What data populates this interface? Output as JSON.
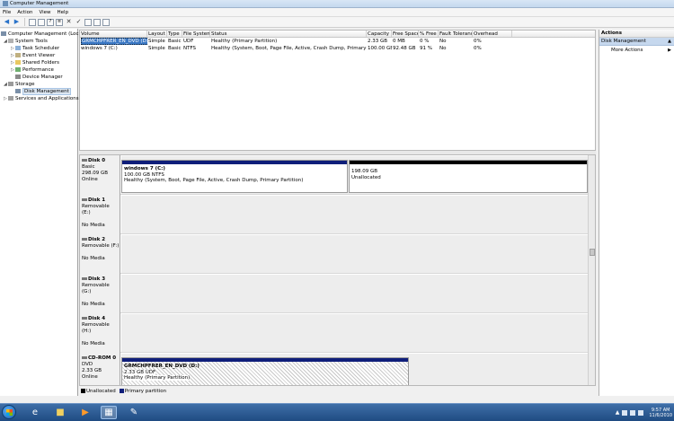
{
  "window": {
    "title": "Computer Management"
  },
  "menu": [
    "File",
    "Action",
    "View",
    "Help"
  ],
  "toolbar": {
    "icons": [
      "back-arrow-icon",
      "forward-arrow-icon",
      "up-folder-icon",
      "properties-icon",
      "help-icon",
      "list-icon",
      "delete-icon",
      "check-icon",
      "export-icon",
      "view-icon",
      "refresh-icon"
    ]
  },
  "tree": {
    "root": "Computer Management (Local",
    "system_tools": "System Tools",
    "task_scheduler": "Task Scheduler",
    "event_viewer": "Event Viewer",
    "shared_folders": "Shared Folders",
    "performance": "Performance",
    "device_manager": "Device Manager",
    "storage": "Storage",
    "disk_management": "Disk Management",
    "services": "Services and Applications"
  },
  "volumes": {
    "headers": [
      "Volume",
      "Layout",
      "Type",
      "File System",
      "Status",
      "Capacity",
      "Free Space",
      "% Free",
      "Fault Tolerance",
      "Overhead"
    ],
    "rows": [
      [
        "GRMCHPFRER_EN_DVD (D:)",
        "Simple",
        "Basic",
        "UDF",
        "Healthy (Primary Partition)",
        "2.33 GB",
        "0 MB",
        "0 %",
        "No",
        "0%"
      ],
      [
        "windows 7 (C:)",
        "Simple",
        "Basic",
        "NTFS",
        "Healthy (System, Boot, Page File, Active, Crash Dump, Primary Partition)",
        "100.00 GB",
        "92.48 GB",
        "91 %",
        "No",
        "0%"
      ]
    ]
  },
  "disks": {
    "d0": {
      "name": "Disk 0",
      "line1": "Basic",
      "line2": "298.09 GB",
      "line3": "Online",
      "p1_name": "windows 7  (C:)",
      "p1_size": "100.00 GB NTFS",
      "p1_status": "Healthy (System, Boot, Page File, Active, Crash Dump, Primary Partition)",
      "p2_size": "198.09 GB",
      "p2_status": "Unallocated"
    },
    "d1": {
      "name": "Disk 1",
      "line1": "Removable (E:)",
      "line2": "No Media"
    },
    "d2": {
      "name": "Disk 2",
      "line1": "Removable (F:)",
      "line2": "No Media"
    },
    "d3": {
      "name": "Disk 3",
      "line1": "Removable (G:)",
      "line2": "No Media"
    },
    "d4": {
      "name": "Disk 4",
      "line1": "Removable (H:)",
      "line2": "No Media"
    },
    "cd": {
      "name": "CD-ROM 0",
      "line1": "DVD",
      "line2": "2.33 GB",
      "line3": "Online",
      "p1_name": "GRMCHPFRER_EN_DVD  (D:)",
      "p1_size": "2.33 GB UDF",
      "p1_status": "Healthy (Primary Partition)"
    }
  },
  "legend": {
    "unallocated": "Unallocated",
    "primary": "Primary partition",
    "colors": {
      "unallocated": "#000000",
      "primary": "#0f1e7a"
    }
  },
  "actions": {
    "header": "Actions",
    "section": "Disk Management",
    "more": "More Actions"
  },
  "taskbar": {
    "time": "9:57 AM",
    "date": "11/6/2010"
  }
}
